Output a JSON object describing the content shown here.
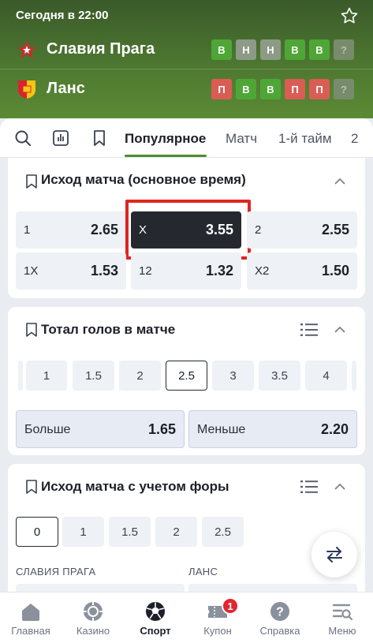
{
  "header": {
    "datetime": "Сегодня в 22:00",
    "teams": [
      {
        "name": "Славия Прага",
        "form": [
          "В",
          "Н",
          "Н",
          "В",
          "В",
          "?"
        ],
        "form_types": [
          "w",
          "d",
          "d",
          "w",
          "w",
          "q"
        ]
      },
      {
        "name": "Ланс",
        "form": [
          "П",
          "В",
          "В",
          "П",
          "П",
          "?"
        ],
        "form_types": [
          "l",
          "w",
          "w",
          "l",
          "l",
          "q"
        ]
      }
    ]
  },
  "tabs": [
    "Популярное",
    "Матч",
    "1-й тайм",
    "2"
  ],
  "active_tab": "Популярное",
  "match_result": {
    "title": "Исход матча (основное время)",
    "odds": [
      {
        "label": "1",
        "value": "2.65"
      },
      {
        "label": "X",
        "value": "3.55",
        "selected": true
      },
      {
        "label": "2",
        "value": "2.55"
      },
      {
        "label": "1X",
        "value": "1.53"
      },
      {
        "label": "12",
        "value": "1.32"
      },
      {
        "label": "X2",
        "value": "1.50"
      }
    ]
  },
  "total_goals": {
    "title": "Тотал голов в матче",
    "lines": [
      "1",
      "1.5",
      "2",
      "2.5",
      "3",
      "3.5",
      "4"
    ],
    "selected_line": "2.5",
    "over": {
      "label": "Больше",
      "value": "1.65"
    },
    "under": {
      "label": "Меньше",
      "value": "2.20"
    }
  },
  "handicap": {
    "title": "Исход матча с учетом форы",
    "lines": [
      "0",
      "1",
      "1.5",
      "2",
      "2.5"
    ],
    "selected_line": "0",
    "team1": "СЛАВИЯ ПРАГА",
    "team2": "ЛАНС"
  },
  "nav": [
    {
      "label": "Главная",
      "icon": "home-icon"
    },
    {
      "label": "Казино",
      "icon": "casino-icon"
    },
    {
      "label": "Спорт",
      "icon": "soccer-ball-icon",
      "active": true
    },
    {
      "label": "Купон",
      "icon": "coupon-icon",
      "badge": "1"
    },
    {
      "label": "Справка",
      "icon": "help-icon"
    },
    {
      "label": "Меню",
      "icon": "menu-icon"
    }
  ],
  "colors": {
    "brand_green": "#4f8d30",
    "selected_odd": "#25292f",
    "highlight_red": "#e02420",
    "badge_red": "#e2262e"
  }
}
